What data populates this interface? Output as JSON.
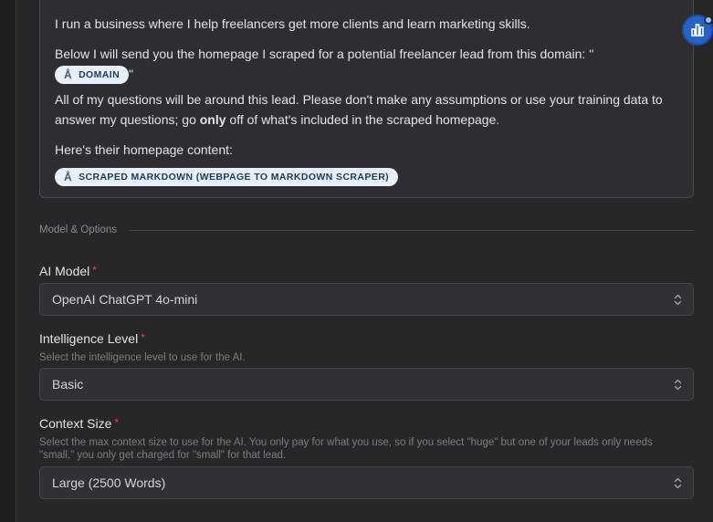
{
  "prompt": {
    "line1": "I run a business where I help freelancers get more clients and learn marketing skills.",
    "line2_before": "Below I will send you the homepage I scraped for a potential freelancer lead from this domain: \"",
    "domain_tag": "DOMAIN",
    "line2_after": "\"",
    "line3_before": "All of my questions will be around this lead. Please don't make any assumptions or use your training data to answer my questions; go ",
    "line3_bold": "only",
    "line3_after": " off of what's included in the scraped homepage.",
    "line4": "Here's their homepage content:",
    "markdown_tag": "SCRAPED MARKDOWN (WEBPAGE TO MARKDOWN SCRAPER)"
  },
  "section": {
    "title": "Model & Options"
  },
  "fields": {
    "ai_model": {
      "label": "AI Model",
      "required_mark": "*",
      "value": "OpenAI ChatGPT 4o-mini"
    },
    "intelligence": {
      "label": "Intelligence Level",
      "required_mark": "*",
      "help": "Select the intelligence level to use for the AI.",
      "value": "Basic"
    },
    "context": {
      "label": "Context Size",
      "required_mark": "*",
      "help": "Select the max context size to use for the AI. You only pay for what you use, so if you select \"huge\" but one of your leads only needs \"small,\" you only get charged for \"small\" for that lead.",
      "value": "Large (2500 Words)"
    }
  },
  "icons": {
    "tag_icon": "variable-icon",
    "fab_icon": "chart-icon",
    "select_icon": "chevron-up-down-icon"
  },
  "colors": {
    "accent": "#2563c9",
    "required": "#ef4444",
    "tag_bg": "#e8f1fb",
    "tag_text": "#1e3a5f"
  }
}
